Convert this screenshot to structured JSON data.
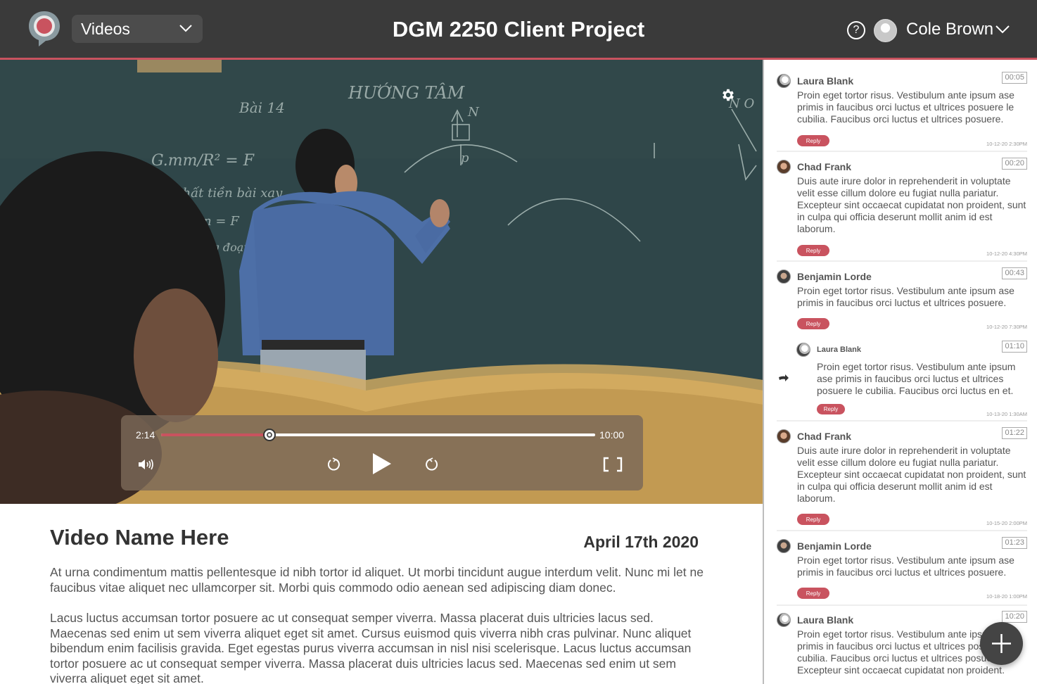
{
  "header": {
    "nav_select": "Videos",
    "title": "DGM 2250 Client Project",
    "help_label": "?",
    "user_name": "Cole Brown"
  },
  "colors": {
    "accent": "#c9535f",
    "topbar": "#3a3a3a"
  },
  "icons": [
    "logo-icon",
    "chevron-down-icon",
    "help-icon",
    "settings-gear-icon",
    "volume-icon",
    "rewind-icon",
    "play-icon",
    "forward-icon",
    "fullscreen-icon",
    "reply-arrow-icon",
    "add-icon"
  ],
  "player": {
    "current_time": "2:14",
    "total_time": "10:00",
    "progress": 0.25
  },
  "video": {
    "name": "Video Name Here",
    "date": "April 17th 2020",
    "paragraphs": [
      "At urna condimentum mattis pellentesque id nibh tortor id aliquet. Ut morbi tincidunt augue interdum velit. Nunc mi let ne faucibus vitae aliquet nec ullamcorper sit. Morbi quis commodo odio aenean sed adipiscing diam donec.",
      "Lacus luctus accumsan tortor posuere ac ut consequat semper viverra. Massa placerat duis ultricies lacus sed. Maecenas sed enim ut sem viverra aliquet eget sit amet. Cursus euismod quis viverra nibh cras pulvinar. Nunc aliquet bibendum enim facilisis gravida. Eget egestas purus viverra accumsan in nisl nisi scelerisque. Lacus luctus accumsan tortor posuere ac ut consequat semper viverra. Massa placerat duis ultricies lacus sed. Maecenas sed enim ut sem viverra aliquet eget sit amet."
    ]
  },
  "comments": [
    {
      "author": "Laura Blank",
      "stamp": "00:05",
      "text": "Proin eget tortor risus. Vestibulum ante ipsum ase primis in faucibus orci luctus et ultrices posuere le cubilia. Faucibus orci luctus et ultrices posuere.",
      "reply": "Reply",
      "date": "10-12-20   2:30PM"
    },
    {
      "author": "Chad Frank",
      "stamp": "00:20",
      "text": "Duis aute irure dolor in reprehenderit in voluptate velit esse cillum dolore eu fugiat nulla pariatur. Excepteur sint occaecat cupidatat non proident, sunt in culpa qui officia deserunt mollit anim id est laborum.",
      "reply": "Reply",
      "date": "10-12-20   4:30PM"
    },
    {
      "author": "Benjamin Lorde",
      "stamp": "00:43",
      "text": "Proin eget tortor risus. Vestibulum ante ipsum ase primis in faucibus orci luctus et ultrices posuere.",
      "reply": "Reply",
      "date": "10-12-20   7:30PM"
    },
    {
      "author": "Laura Blank",
      "stamp": "01:10",
      "text": "Proin eget tortor risus. Vestibulum ante ipsum ase primis in faucibus orci luctus et ultrices posuere le cubilia. Faucibus orci luctus en et.",
      "reply": "Reply",
      "date": "10-13-20   1:30AM"
    },
    {
      "author": "Chad Frank",
      "stamp": "01:22",
      "text": "Duis aute irure dolor in reprehenderit in voluptate velit esse cillum dolore eu fugiat nulla pariatur. Excepteur sint occaecat cupidatat non proident, sunt in culpa qui officia deserunt mollit anim id est laborum.",
      "reply": "Reply",
      "date": "10-15-20   2:00PM"
    },
    {
      "author": "Benjamin Lorde",
      "stamp": "01:23",
      "text": "Proin eget tortor risus. Vestibulum ante ipsum ase primis in faucibus orci luctus et ultrices posuere.",
      "reply": "Reply",
      "date": "10-18-20   1:00PM"
    },
    {
      "author": "Laura Blank",
      "stamp": "10:20",
      "text": "Proin eget tortor risus. Vestibulum ante ipsum ase primis in faucibus orci luctus et ultrices posuere le cubilia. Faucibus orci luctus et ultrices posuere. Excepteur sint occaecat cupidatat non proident."
    }
  ]
}
